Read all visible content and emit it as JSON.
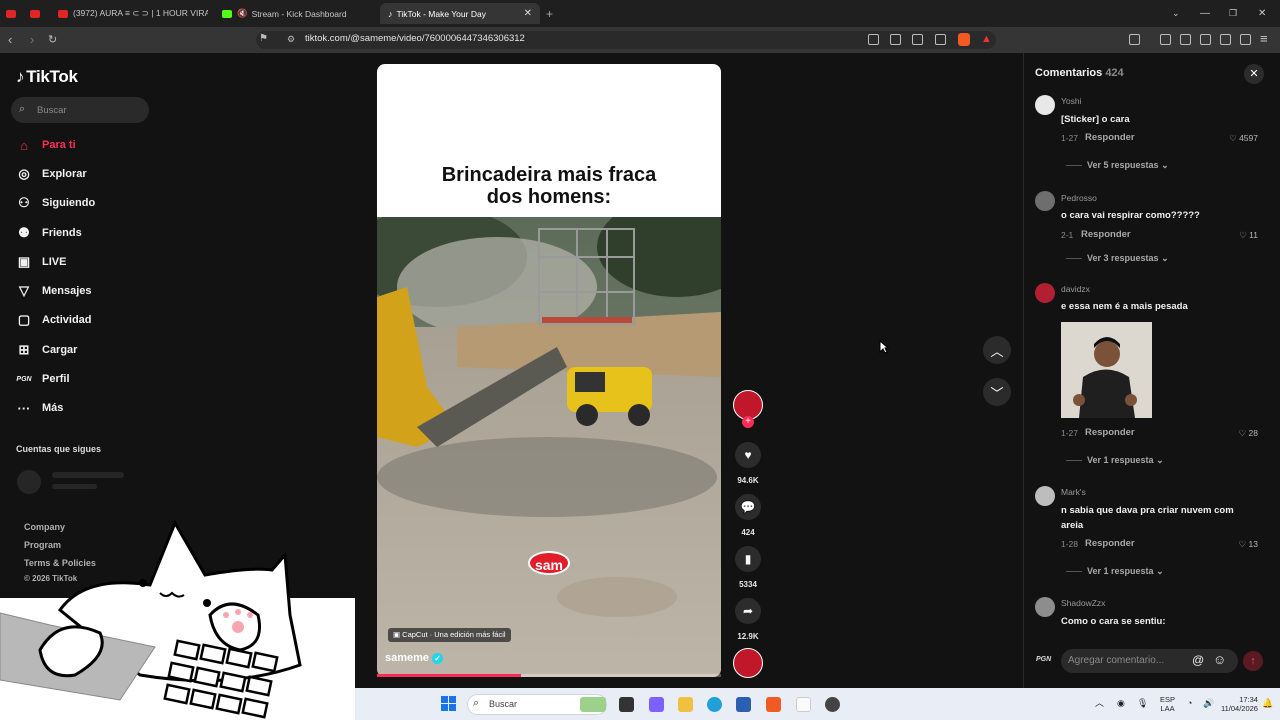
{
  "browser": {
    "tabs": [
      {
        "label": "",
        "color": "#e02525"
      },
      {
        "label": "",
        "color": "#e02525"
      },
      {
        "label": "(3972) AURA ≡ ⊂ ⊃ | 1 HOUR VIRAL A",
        "color": "#e02525"
      },
      {
        "label": "Stream - Kick Dashboard",
        "color": "#53fc18"
      },
      {
        "label": "TikTok - Make Your Day",
        "color": "#ffffff"
      }
    ],
    "url": "tiktok.com/@sameme/video/7600006447346306312"
  },
  "sidebar": {
    "logo": "TikTok",
    "search_placeholder": "Buscar",
    "nav": [
      {
        "label": "Para ti",
        "icon": "home-icon"
      },
      {
        "label": "Explorar",
        "icon": "compass-icon"
      },
      {
        "label": "Siguiendo",
        "icon": "following-icon"
      },
      {
        "label": "Friends",
        "icon": "friends-icon"
      },
      {
        "label": "LIVE",
        "icon": "live-icon"
      },
      {
        "label": "Mensajes",
        "icon": "messages-icon"
      },
      {
        "label": "Actividad",
        "icon": "activity-icon"
      },
      {
        "label": "Cargar",
        "icon": "upload-icon"
      },
      {
        "label": "Perfil",
        "icon": "profile-icon"
      },
      {
        "label": "Más",
        "icon": "more-icon"
      }
    ],
    "following_title": "Cuentas que sigues",
    "footer": [
      "Company",
      "Program",
      "Terms & Policies",
      "© 2026 TikTok"
    ]
  },
  "video": {
    "title_line1": "Brincadeira mais fraca",
    "title_line2": "dos homens:",
    "username": "sameme",
    "capcut_label": "CapCut · Una edición más fácil",
    "watermark": "sam",
    "progress": 0.42
  },
  "actions": {
    "likes": "94.6K",
    "comments": "424",
    "saves": "5334",
    "shares": "12.9K"
  },
  "comments": {
    "title": "Comentarios",
    "count": "424",
    "input_placeholder": "Agregar comentario...",
    "items": [
      {
        "user": "Yoshi",
        "text": "[Sticker] o cara",
        "date": "1-27",
        "reply": "Responder",
        "likes": "4597",
        "more": "Ver 5 respuestas"
      },
      {
        "user": "Pedrosso",
        "text": "o cara vai respirar como?????",
        "date": "2-1",
        "reply": "Responder",
        "likes": "11",
        "more": "Ver 3 respuestas"
      },
      {
        "user": "davidzx",
        "text": "e essa nem é a mais pesada",
        "date": "1-27",
        "reply": "Responder",
        "likes": "28",
        "more": "Ver 1 respuesta"
      },
      {
        "user": "Mark's",
        "text": "n sabia que dava pra criar nuvem com areia",
        "date": "1-28",
        "reply": "Responder",
        "likes": "13",
        "more": "Ver 1 respuesta"
      },
      {
        "user": "ShadowZzx",
        "text": "Como o cara se sentiu:"
      }
    ]
  },
  "taskbar": {
    "search": "Buscar",
    "lang1": "ESP",
    "lang2": "LAA",
    "time": "17:34",
    "date": "11/04/2026"
  }
}
